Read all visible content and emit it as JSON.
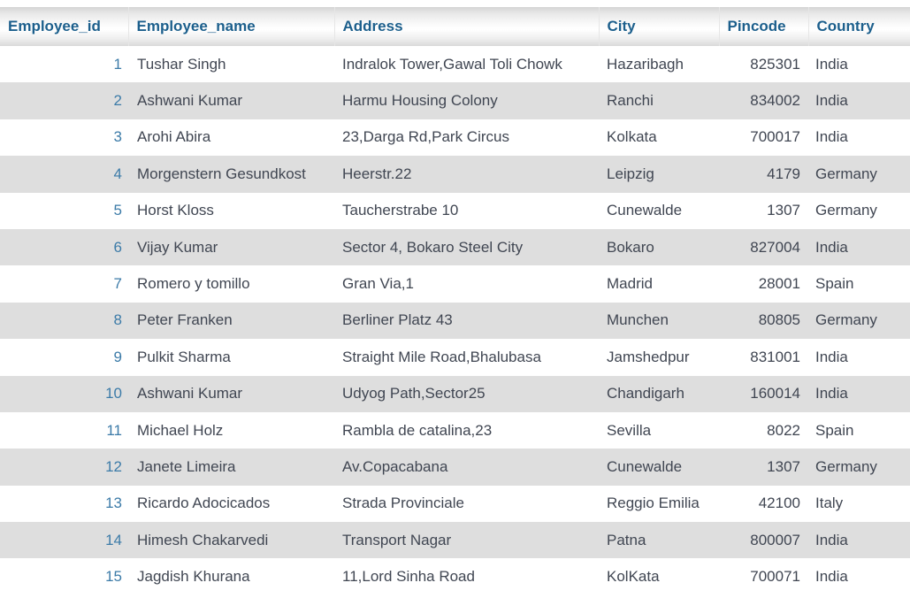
{
  "table": {
    "name": "employee-table",
    "colors": {
      "header_text": "#1c5f8c",
      "row_text": "#404652",
      "id_text": "#3c7ba8",
      "row_odd_bg": "#ffffff",
      "row_even_bg": "#dedede"
    },
    "columns": [
      {
        "key": "employee_id",
        "label": "Employee_id",
        "align": "right"
      },
      {
        "key": "employee_name",
        "label": "Employee_name",
        "align": "left"
      },
      {
        "key": "address",
        "label": "Address",
        "align": "left"
      },
      {
        "key": "city",
        "label": "City",
        "align": "left"
      },
      {
        "key": "pincode",
        "label": "Pincode",
        "align": "right"
      },
      {
        "key": "country",
        "label": "Country",
        "align": "left"
      }
    ],
    "rows": [
      {
        "employee_id": "1",
        "employee_name": "Tushar Singh",
        "address": "Indralok Tower,Gawal Toli Chowk",
        "city": "Hazaribagh",
        "pincode": "825301",
        "country": "India"
      },
      {
        "employee_id": "2",
        "employee_name": "Ashwani Kumar",
        "address": "Harmu Housing Colony",
        "city": "Ranchi",
        "pincode": "834002",
        "country": "India"
      },
      {
        "employee_id": "3",
        "employee_name": "Arohi Abira",
        "address": "23,Darga Rd,Park Circus",
        "city": "Kolkata",
        "pincode": "700017",
        "country": "India"
      },
      {
        "employee_id": "4",
        "employee_name": "Morgenstern Gesundkost",
        "address": "Heerstr.22",
        "city": "Leipzig",
        "pincode": "4179",
        "country": "Germany"
      },
      {
        "employee_id": "5",
        "employee_name": "Horst Kloss",
        "address": "Taucherstrabe 10",
        "city": "Cunewalde",
        "pincode": "1307",
        "country": "Germany"
      },
      {
        "employee_id": "6",
        "employee_name": "Vijay Kumar",
        "address": "Sector 4, Bokaro Steel City",
        "city": "Bokaro",
        "pincode": "827004",
        "country": "India"
      },
      {
        "employee_id": "7",
        "employee_name": "Romero y tomillo",
        "address": "Gran Via,1",
        "city": "Madrid",
        "pincode": "28001",
        "country": "Spain"
      },
      {
        "employee_id": "8",
        "employee_name": "Peter Franken",
        "address": "Berliner Platz 43",
        "city": "Munchen",
        "pincode": "80805",
        "country": "Germany"
      },
      {
        "employee_id": "9",
        "employee_name": "Pulkit Sharma",
        "address": "Straight Mile Road,Bhalubasa",
        "city": "Jamshedpur",
        "pincode": "831001",
        "country": "India"
      },
      {
        "employee_id": "10",
        "employee_name": "Ashwani Kumar",
        "address": "Udyog Path,Sector25",
        "city": "Chandigarh",
        "pincode": "160014",
        "country": "India"
      },
      {
        "employee_id": "11",
        "employee_name": "Michael Holz",
        "address": "Rambla de catalina,23",
        "city": "Sevilla",
        "pincode": "8022",
        "country": "Spain"
      },
      {
        "employee_id": "12",
        "employee_name": "Janete Limeira",
        "address": "Av.Copacabana",
        "city": "Cunewalde",
        "pincode": "1307",
        "country": "Germany"
      },
      {
        "employee_id": "13",
        "employee_name": "Ricardo Adocicados",
        "address": "Strada Provinciale",
        "city": "Reggio Emilia",
        "pincode": "42100",
        "country": "Italy"
      },
      {
        "employee_id": "14",
        "employee_name": "Himesh Chakarvedi",
        "address": "Transport Nagar",
        "city": "Patna",
        "pincode": "800007",
        "country": "India"
      },
      {
        "employee_id": "15",
        "employee_name": "Jagdish Khurana",
        "address": "11,Lord Sinha Road",
        "city": "KolKata",
        "pincode": "700071",
        "country": "India"
      }
    ]
  }
}
